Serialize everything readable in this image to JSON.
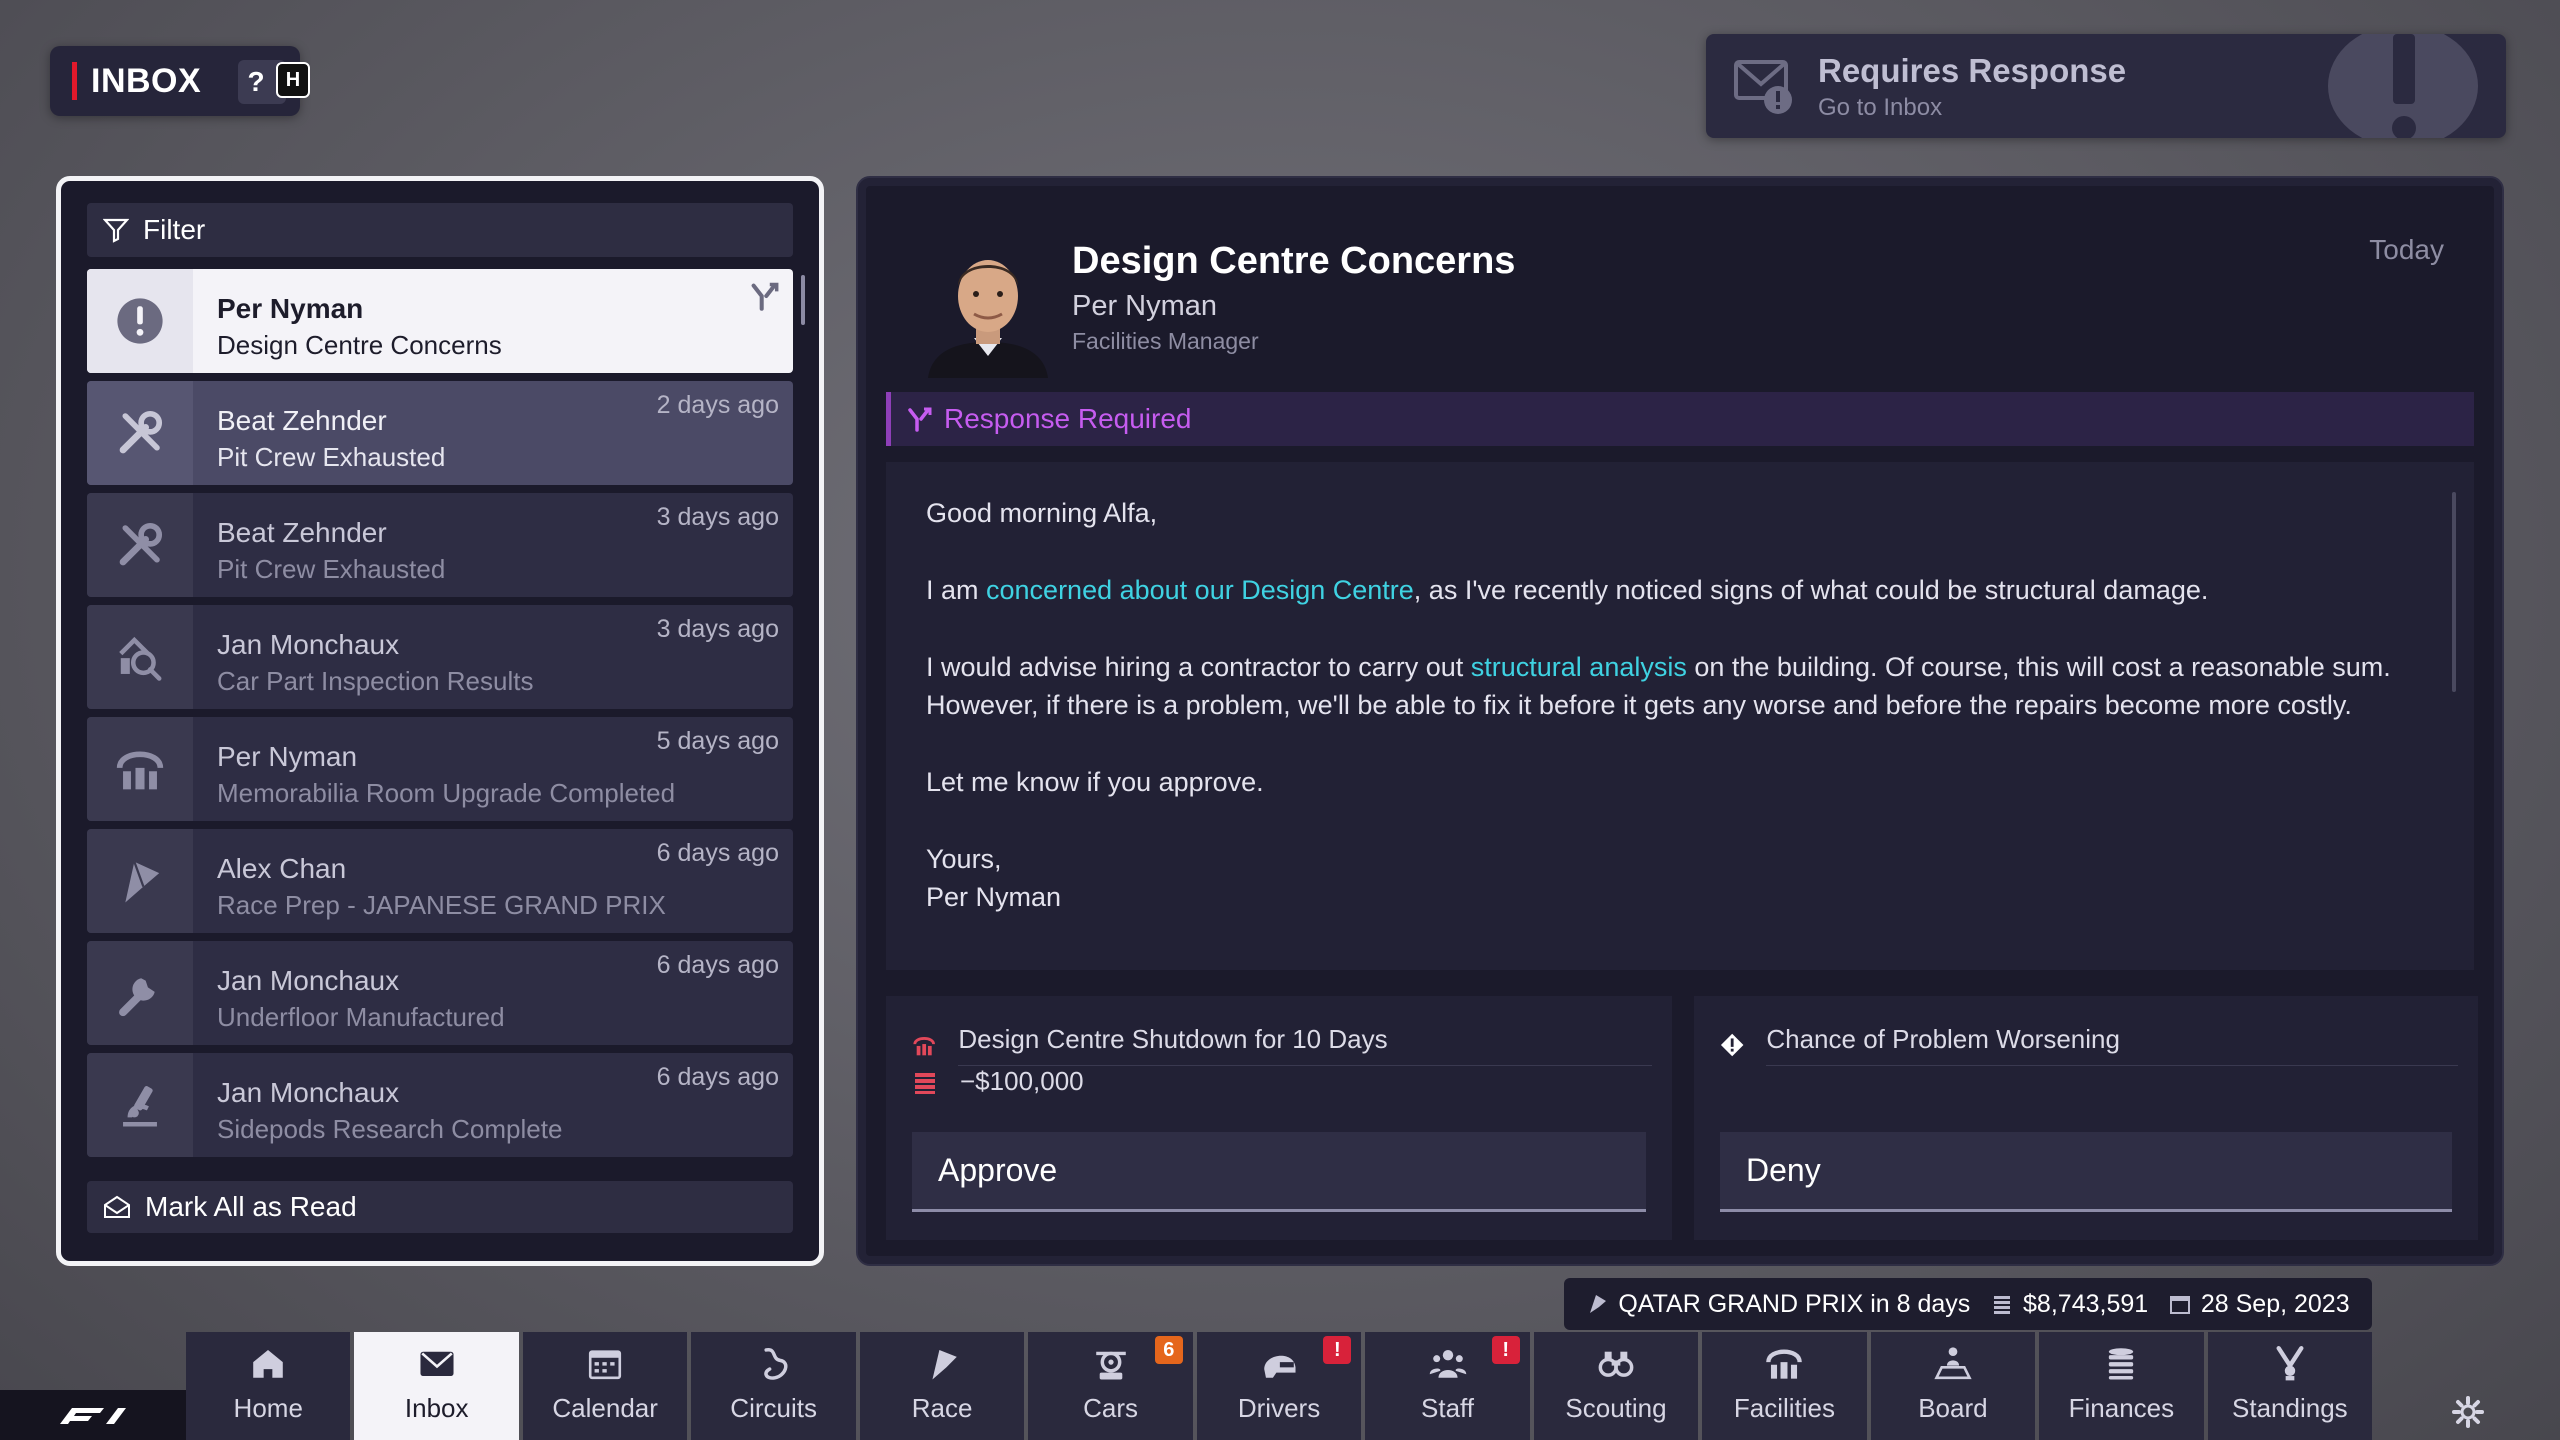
{
  "header": {
    "title": "INBOX",
    "help": "?",
    "hotkey": "H"
  },
  "notification": {
    "title": "Requires Response",
    "subtitle": "Go to Inbox"
  },
  "list": {
    "filter_label": "Filter",
    "mark_all_label": "Mark All as Read",
    "messages": [
      {
        "sender": "Per Nyman",
        "subject": "Design Centre Concerns",
        "time": "",
        "icon": "exclamation-icon",
        "state": "active"
      },
      {
        "sender": "Beat Zehnder",
        "subject": "Pit Crew Exhausted",
        "time": "2 days ago",
        "icon": "tools-icon",
        "state": "unread"
      },
      {
        "sender": "Beat Zehnder",
        "subject": "Pit Crew Exhausted",
        "time": "3 days ago",
        "icon": "tools-icon",
        "state": "read"
      },
      {
        "sender": "Jan Monchaux",
        "subject": "Car Part Inspection Results",
        "time": "3 days ago",
        "icon": "inspection-icon",
        "state": "read"
      },
      {
        "sender": "Per Nyman",
        "subject": "Memorabilia Room Upgrade Completed",
        "time": "5 days ago",
        "icon": "facility-icon",
        "state": "read"
      },
      {
        "sender": "Alex Chan",
        "subject": "Race Prep - JAPANESE GRAND PRIX",
        "time": "6 days ago",
        "icon": "flag-icon",
        "state": "read"
      },
      {
        "sender": "Jan Monchaux",
        "subject": "Underfloor Manufactured",
        "time": "6 days ago",
        "icon": "wrench-icon",
        "state": "read"
      },
      {
        "sender": "Jan Monchaux",
        "subject": "Sidepods Research Complete",
        "time": "6 days ago",
        "icon": "microscope-icon",
        "state": "read"
      }
    ]
  },
  "detail": {
    "title": "Design Centre Concerns",
    "from": "Per Nyman",
    "role": "Facilities Manager",
    "date": "Today",
    "response_label": "Response Required",
    "body": {
      "greeting": "Good morning Alfa,",
      "p1_a": "I am ",
      "p1_link": "concerned about our Design Centre",
      "p1_b": ", as I've recently noticed signs of what could be structural damage.",
      "p2_a": "I would advise hiring a contractor to carry out ",
      "p2_link": "structural analysis",
      "p2_b": " on the building. Of course, this will cost a reasonable sum. However, if there is a problem, we'll be able to fix it before it gets any worse and before the repairs become more costly.",
      "p3": "Let me know if you approve.",
      "signoff": "Yours,",
      "signature": "Per Nyman"
    },
    "options": {
      "approve": {
        "effect1": "Design Centre Shutdown for 10 Days",
        "effect2": "−$100,000",
        "button": "Approve"
      },
      "deny": {
        "effect1": "Chance of Problem Worsening",
        "button": "Deny"
      }
    }
  },
  "status": {
    "next_race": "QATAR GRAND PRIX in 8 days",
    "balance": "$8,743,591",
    "date": "28 Sep, 2023"
  },
  "nav": [
    {
      "label": "Home",
      "icon": "home-icon"
    },
    {
      "label": "Inbox",
      "icon": "envelope-icon",
      "active": true
    },
    {
      "label": "Calendar",
      "icon": "calendar-icon"
    },
    {
      "label": "Circuits",
      "icon": "circuit-icon"
    },
    {
      "label": "Race",
      "icon": "race-flag-icon"
    },
    {
      "label": "Cars",
      "icon": "car-icon",
      "badge": "6"
    },
    {
      "label": "Drivers",
      "icon": "helmet-icon",
      "badge": "!"
    },
    {
      "label": "Staff",
      "icon": "staff-icon",
      "badge": "!"
    },
    {
      "label": "Scouting",
      "icon": "binoculars-icon"
    },
    {
      "label": "Facilities",
      "icon": "facility-icon"
    },
    {
      "label": "Board",
      "icon": "board-icon"
    },
    {
      "label": "Finances",
      "icon": "coins-icon"
    },
    {
      "label": "Standings",
      "icon": "trophy-icon"
    }
  ],
  "colors": {
    "accent_red": "#e2192b",
    "link": "#3fd2e2",
    "response": "#c65cf0",
    "badge_orange": "#e5661c",
    "badge_red": "#d8223a"
  }
}
